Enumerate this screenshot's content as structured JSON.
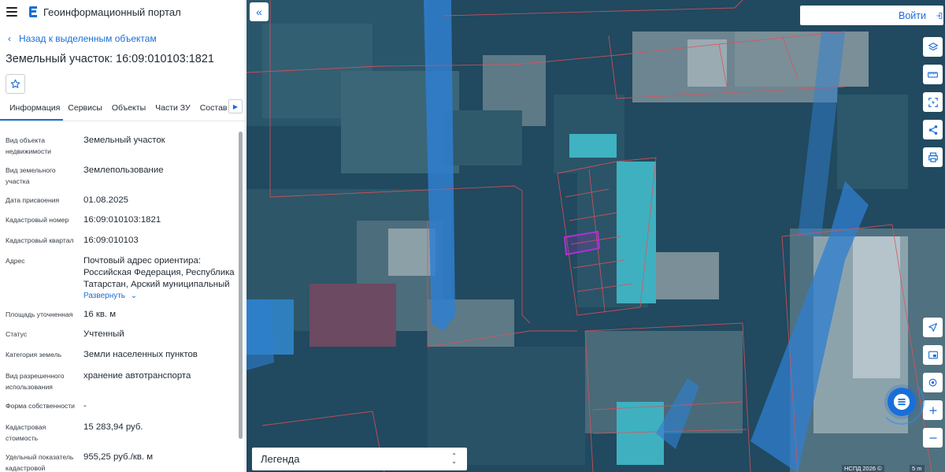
{
  "header": {
    "app_title": "Геоинформационный портал",
    "back_label": "Назад к выделенным объектам",
    "object_title": "Земельный участок: 16:09:010103:1821"
  },
  "tabs": [
    "Информация",
    "Сервисы",
    "Объекты",
    "Части ЗУ",
    "Состав"
  ],
  "fields": [
    {
      "label": "Вид объекта недвижимости",
      "value": "Земельный участок"
    },
    {
      "label": "Вид земельного участка",
      "value": "Землепользование"
    },
    {
      "label": "Дата присвоения",
      "value": "01.08.2025"
    },
    {
      "label": "Кадастровый номер",
      "value": "16:09:010103:1821"
    },
    {
      "label": "Кадастровый квартал",
      "value": "16:09:010103"
    },
    {
      "label": "Адрес",
      "value": "Почтовый адрес ориентира: Российская Федерация, Республика Татарстан, Арский муниципальный"
    },
    {
      "label": "Площадь уточненная",
      "value": "16 кв. м"
    },
    {
      "label": "Статус",
      "value": "Учтенный"
    },
    {
      "label": "Категория земель",
      "value": "Земли населенных пунктов"
    },
    {
      "label": "Вид разрешенного использования",
      "value": "хранение автотранспорта"
    },
    {
      "label": "Форма собственности",
      "value": "-"
    },
    {
      "label": "Кадастровая стоимость",
      "value": "15 283,94 руб."
    },
    {
      "label": "Удельный показатель кадастровой",
      "value": "955,25 руб./кв. м"
    }
  ],
  "expand_label": "Развернуть",
  "map": {
    "login_label": "Войти",
    "legend_label": "Легенда",
    "attribution": "НСПД 2026 ©",
    "scale_label": "5 m"
  },
  "icons": {
    "menu": "burger-icon",
    "logo": "portal-logo-icon",
    "favorite": "star-icon",
    "collapse": "double-chevron-left-icon",
    "login": "login-arrow-icon",
    "tools": [
      "layers-icon",
      "ruler-icon",
      "select-area-icon",
      "share-icon",
      "print-icon",
      "location-arrow-icon",
      "minimap-icon",
      "geolocation-icon",
      "zoom-in-icon",
      "zoom-out-icon"
    ],
    "chat": "chat-icon"
  },
  "colors": {
    "accent": "#1a6ed8",
    "selected_parcel": "#b02fd6",
    "parcel_boundary": "#e0505a"
  }
}
